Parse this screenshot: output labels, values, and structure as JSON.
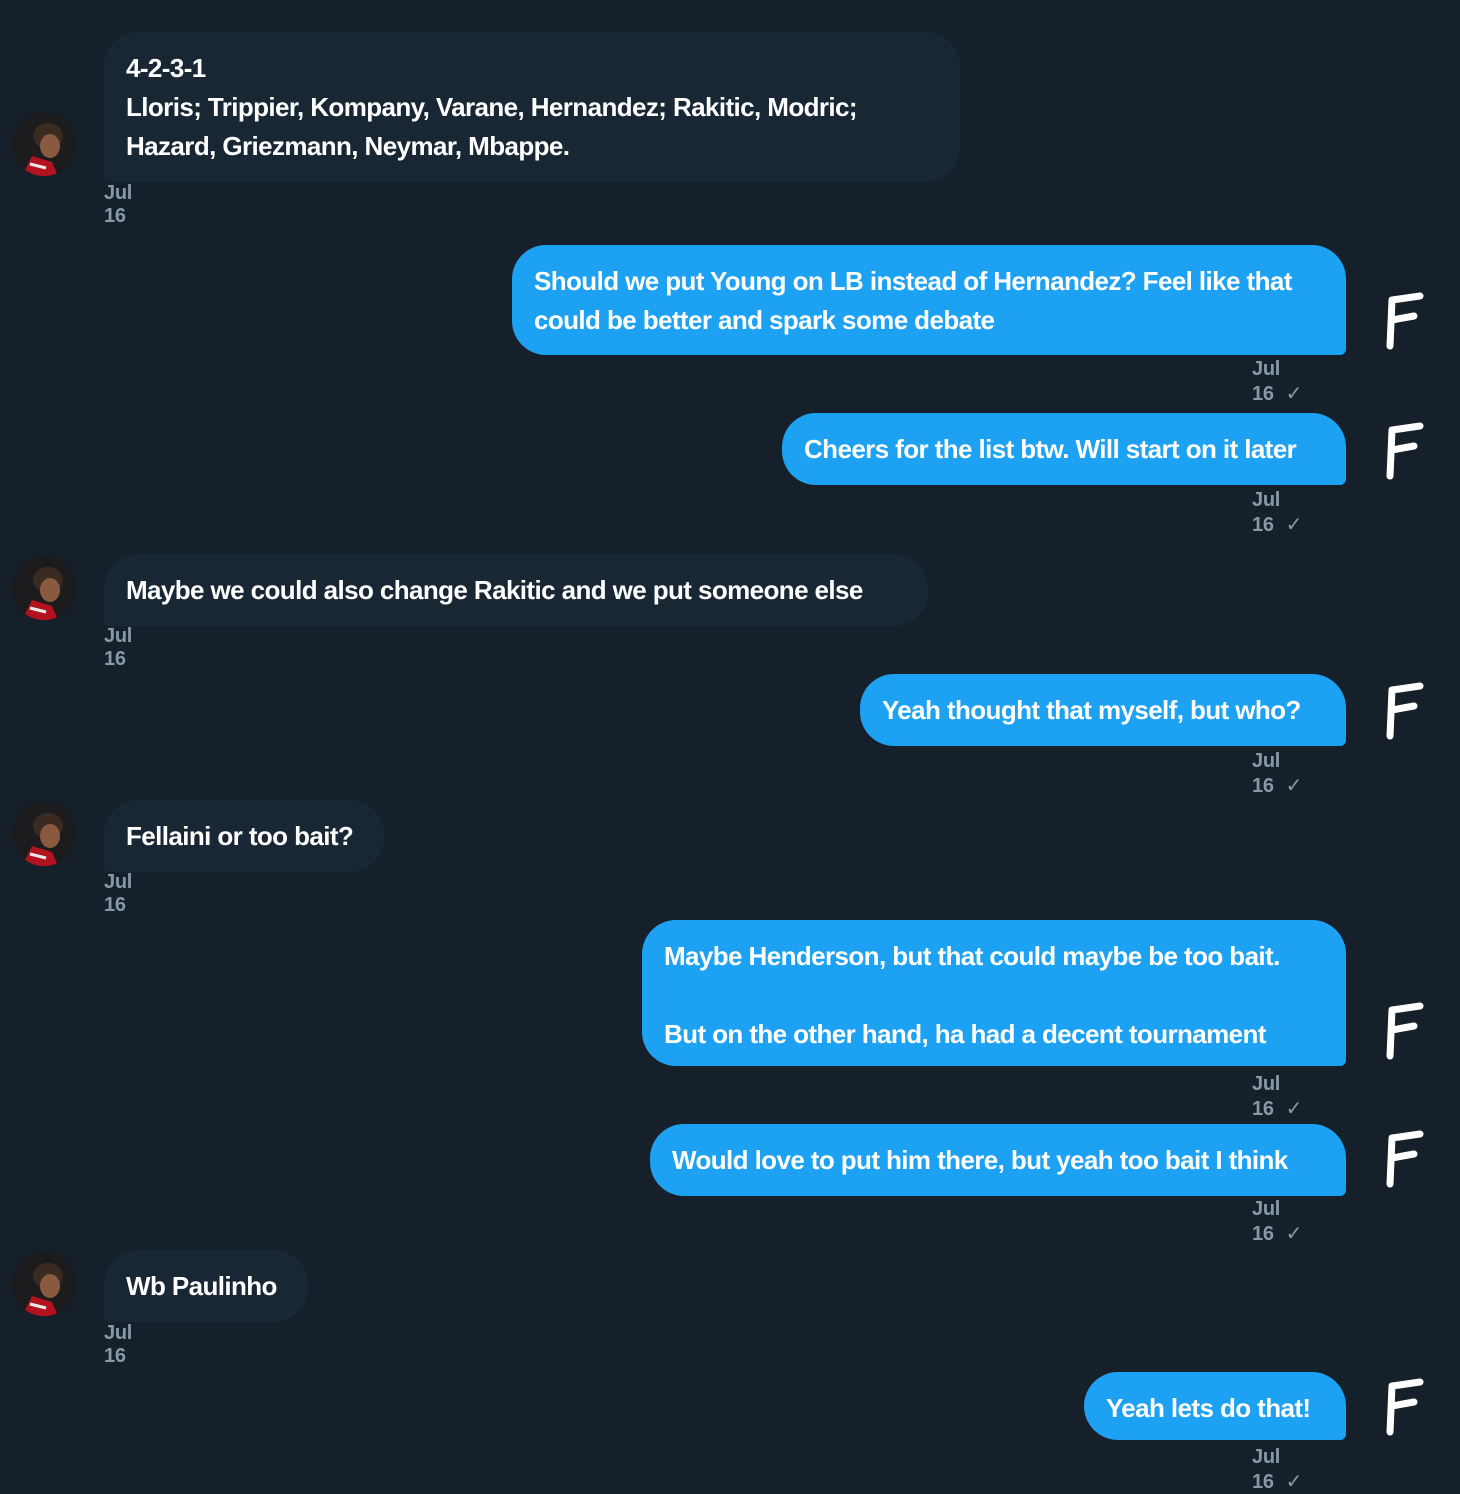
{
  "messages": [
    {
      "dir": "in",
      "text": "4-2-3-1\nLloris; Trippier, Kompany, Varane, Hernandez; Rakitic, Modric;\nHazard, Griezmann, Neymar, Mbappe.",
      "time": "Jul 16"
    },
    {
      "dir": "out",
      "text": "Should we put Young on LB instead of Hernandez? Feel like that\ncould be better and spark some debate",
      "time": "Jul 16"
    },
    {
      "dir": "out",
      "text": "Cheers for the list btw. Will start on it later",
      "time": "Jul 16"
    },
    {
      "dir": "in",
      "text": "Maybe we could also change Rakitic and we put someone else",
      "time": "Jul 16"
    },
    {
      "dir": "out",
      "text": "Yeah thought that myself, but who?",
      "time": "Jul 16"
    },
    {
      "dir": "in",
      "text": "Fellaini or too bait?",
      "time": "Jul 16"
    },
    {
      "dir": "out",
      "text": "Maybe Henderson, but that could maybe be too bait.\n\nBut on the other hand, ha had a decent tournament",
      "time": "Jul 16"
    },
    {
      "dir": "out",
      "text": "Would love to put him there, but yeah too bait I think",
      "time": "Jul 16"
    },
    {
      "dir": "in",
      "text": "Wb Paulinho",
      "time": "Jul 16"
    },
    {
      "dir": "out",
      "text": "Yeah lets do that!",
      "time": "Jul 16"
    }
  ],
  "read_receipt_icon": "check-icon",
  "colors": {
    "background": "#15202b",
    "incoming_bubble": "#192734",
    "outgoing_bubble": "#1da1f2",
    "meta_text": "#8899a6"
  }
}
